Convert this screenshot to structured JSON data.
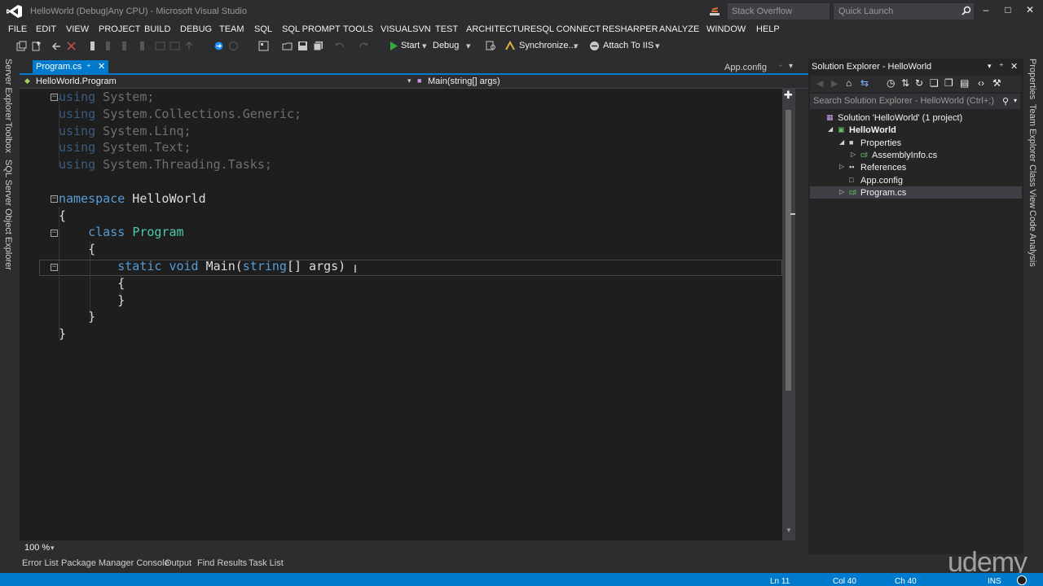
{
  "window": {
    "title": "HelloWorld (Debug|Any CPU) - Microsoft Visual Studio",
    "stack_overflow": "Stack Overflow",
    "quick_launch": "Quick Launch"
  },
  "menu": [
    "FILE",
    "EDIT",
    "VIEW",
    "PROJECT",
    "BUILD",
    "DEBUG",
    "TEAM",
    "SQL",
    "SQL PROMPT",
    "TOOLS",
    "VISUALSVN",
    "TEST",
    "ARCHITECTURE",
    "SQL CONNECT",
    "RESHARPER",
    "ANALYZE",
    "WINDOW",
    "HELP"
  ],
  "toolbar": {
    "start": "Start",
    "config": "Debug",
    "synchronize": "Synchronize...",
    "attach": "Attach To IIS"
  },
  "left_tabs": [
    "Server Explorer",
    "Toolbox",
    "SQL Server Object Explorer"
  ],
  "editor": {
    "active_tab": "Program.cs",
    "other_tab": "App.config",
    "nav_left": "HelloWorld.Program",
    "nav_right": "Main(string[] args)",
    "zoom": "100 %",
    "code": [
      [
        [
          "dimkw",
          "using"
        ],
        [
          "dim",
          " System;"
        ]
      ],
      [
        [
          "dimkw",
          "using"
        ],
        [
          "dim",
          " System.Collections.Generic;"
        ]
      ],
      [
        [
          "dimkw",
          "using"
        ],
        [
          "dim",
          " System.Linq;"
        ]
      ],
      [
        [
          "dimkw",
          "using"
        ],
        [
          "dim",
          " System.Text;"
        ]
      ],
      [
        [
          "dimkw",
          "using"
        ],
        [
          "dim",
          " System.Threading.Tasks;"
        ]
      ],
      [],
      [
        [
          "kw",
          "namespace"
        ],
        [
          "plain",
          " HelloWorld"
        ]
      ],
      [
        [
          "plain",
          "{"
        ]
      ],
      [
        [
          "plain",
          "    "
        ],
        [
          "kw",
          "class"
        ],
        [
          "plain",
          " "
        ],
        [
          "typ",
          "Program"
        ]
      ],
      [
        [
          "plain",
          "    {"
        ]
      ],
      [
        [
          "plain",
          "        "
        ],
        [
          "kw",
          "static"
        ],
        [
          "plain",
          " "
        ],
        [
          "kw",
          "void"
        ],
        [
          "plain",
          " Main("
        ],
        [
          "kw",
          "string"
        ],
        [
          "plain",
          "[] args)"
        ]
      ],
      [
        [
          "plain",
          "        {"
        ]
      ],
      [
        [
          "plain",
          "        }"
        ]
      ],
      [
        [
          "plain",
          "    }"
        ]
      ],
      [
        [
          "plain",
          "}"
        ]
      ]
    ]
  },
  "solution_explorer": {
    "title": "Solution Explorer - HelloWorld",
    "search_placeholder": "Search Solution Explorer - HelloWorld (Ctrl+;)",
    "items": [
      {
        "label": "Solution 'HelloWorld' (1 project)",
        "icon": "solution-icon",
        "level": 0,
        "expander": ""
      },
      {
        "label": "HelloWorld",
        "icon": "csharp-project-icon",
        "level": 1,
        "expander": "expanded",
        "bold": true
      },
      {
        "label": "Properties",
        "icon": "properties-icon",
        "level": 2,
        "expander": "expanded"
      },
      {
        "label": "AssemblyInfo.cs",
        "icon": "csharp-file-icon",
        "level": 3,
        "expander": "collapsed"
      },
      {
        "label": "References",
        "icon": "references-icon",
        "level": 2,
        "expander": "collapsed"
      },
      {
        "label": "App.config",
        "icon": "config-file-icon",
        "level": 2,
        "expander": ""
      },
      {
        "label": "Program.cs",
        "icon": "csharp-file-icon",
        "level": 2,
        "expander": "collapsed",
        "selected": true
      }
    ]
  },
  "right_tabs": [
    "Properties",
    "Team Explorer",
    "Class View",
    "Code Analysis"
  ],
  "bottom_tabs": [
    "Error List",
    "Package Manager Console",
    "Output",
    "Find Results",
    "Task List"
  ],
  "watermark": "udemy",
  "status": {
    "line": "Ln 11",
    "col": "Col 40",
    "ch": "Ch 40",
    "mode": "INS"
  },
  "colors": {
    "accent": "#007acc",
    "keyword": "#569cd6",
    "type": "#4ec9b0",
    "background": "#2d2d30",
    "editor_bg": "#1e1e1e"
  }
}
